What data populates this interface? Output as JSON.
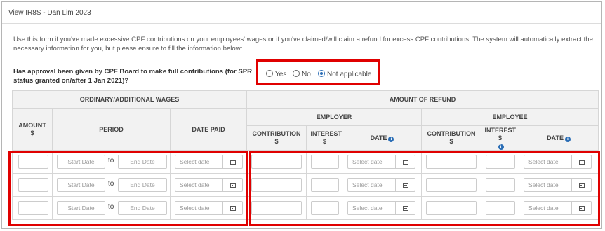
{
  "window": {
    "title": "View IR8S - Dan Lim 2023"
  },
  "intro": "Use this form if you've made excessive CPF contributions on your employees' wages or if you've claimed/will claim a refund for excess CPF contributions. The system will automatically extract the necessary information for you, but please ensure to fill the information below:",
  "question": "Has approval been given by CPF Board to make full contributions (for SPR status granted on/after 1 Jan 2021)?",
  "approval_options": [
    {
      "label": "Yes",
      "selected": false
    },
    {
      "label": "No",
      "selected": false
    },
    {
      "label": "Not applicable",
      "selected": true
    }
  ],
  "table": {
    "group_headers": {
      "wages": "ORDINARY/ADDITIONAL WAGES",
      "refund": "AMOUNT OF REFUND"
    },
    "sub_headers": {
      "employer": "EMPLOYER",
      "employee": "EMPLOYEE"
    },
    "columns": {
      "amount": "AMOUNT $",
      "period": "PERIOD",
      "date_paid": "DATE PAID",
      "employer_contribution": "CONTRIBUTION $",
      "employer_interest": "INTEREST $",
      "employer_date": "DATE",
      "employee_contribution": "CONTRIBUTION $",
      "employee_interest": "INTEREST $",
      "employee_date": "DATE"
    },
    "placeholders": {
      "start_date": "Start Date",
      "end_date": "End Date",
      "select_date": "Select date"
    },
    "to_label": "to",
    "row_count": 3
  },
  "colors": {
    "highlight_border": "#e00000",
    "accent": "#2a6db5",
    "header_bg": "#f2f2f2"
  },
  "icons": [
    "info-icon",
    "calendar-icon",
    "radio-icon"
  ]
}
